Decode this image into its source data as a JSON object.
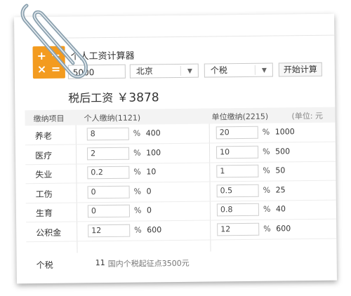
{
  "app": {
    "title": "个人工资计算器"
  },
  "inputs": {
    "salary": "5000",
    "city": "北京",
    "tax_type": "个税",
    "calc_button": "开始计算"
  },
  "result": {
    "label": "税后工资",
    "currency": "￥",
    "amount": "3878"
  },
  "table": {
    "col_item": "缴纳项目",
    "col_personal": "个人缴纳(1121)",
    "col_company": "单位缴纳(2215)",
    "col_unit": "(单位: 元",
    "percent_sign": "%",
    "rows": [
      {
        "label": "养老",
        "p_rate": "8",
        "p_amt": "400",
        "c_rate": "20",
        "c_amt": "1000"
      },
      {
        "label": "医疗",
        "p_rate": "2",
        "p_amt": "100",
        "c_rate": "10",
        "c_amt": "500"
      },
      {
        "label": "失业",
        "p_rate": "0.2",
        "p_amt": "10",
        "c_rate": "1",
        "c_amt": "50"
      },
      {
        "label": "工伤",
        "p_rate": "0",
        "p_amt": "0",
        "c_rate": "0.5",
        "c_amt": "25"
      },
      {
        "label": "生育",
        "p_rate": "0",
        "p_amt": "0",
        "c_rate": "0.8",
        "c_amt": "40"
      },
      {
        "label": "公积金",
        "p_rate": "12",
        "p_amt": "600",
        "c_rate": "12",
        "c_amt": "600"
      }
    ],
    "tax": {
      "label": "个税",
      "value": "11",
      "note": "国内个税起征点3500元"
    }
  },
  "colors": {
    "logo": "#f39b1f",
    "clip": "#8aa0ae"
  },
  "icons": {
    "logo": "calculator-icon",
    "clip": "paperclip-icon",
    "caret": "chevron-down-icon"
  }
}
